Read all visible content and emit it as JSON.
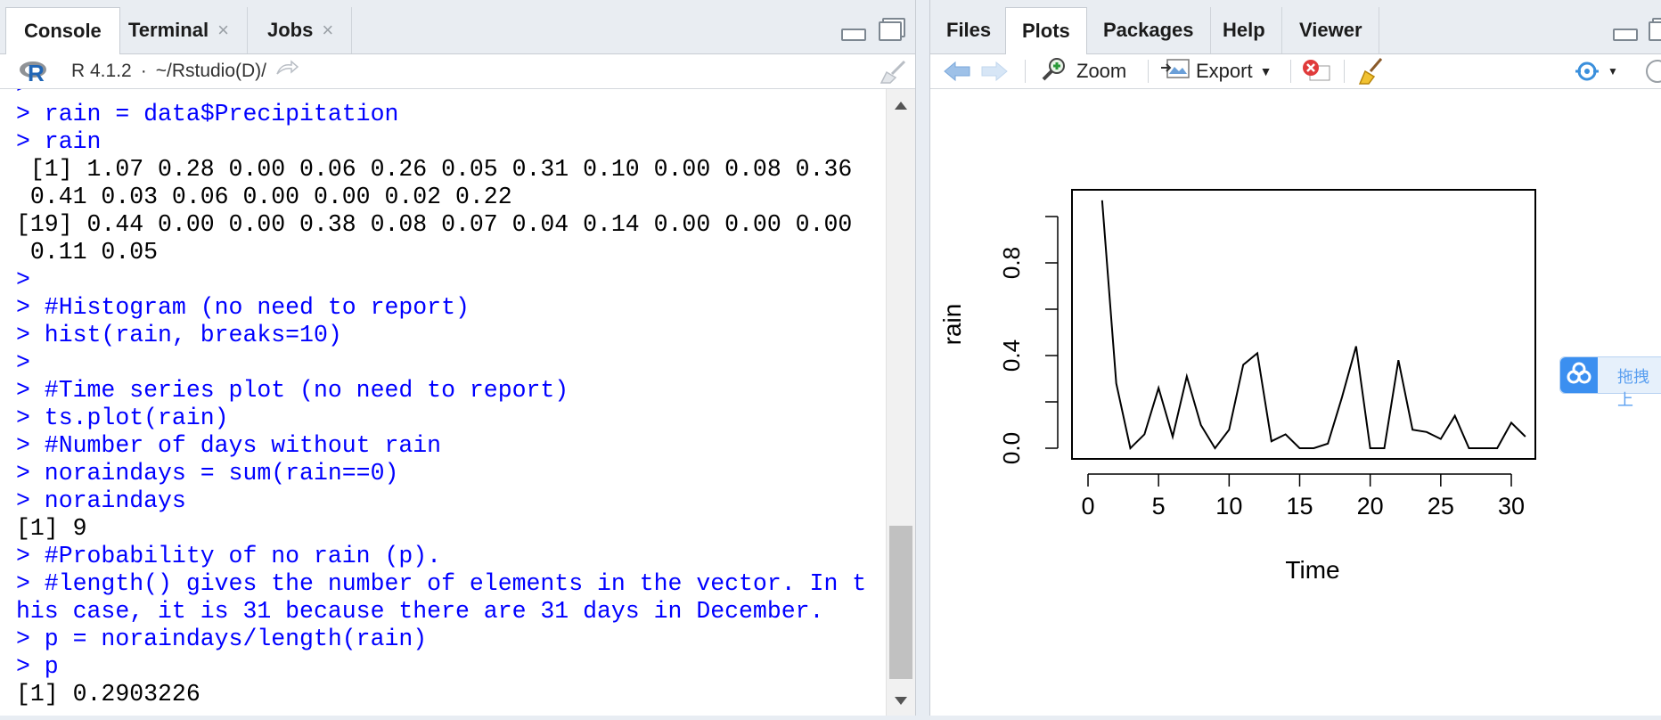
{
  "left_pane": {
    "tabs": [
      {
        "label": "Console",
        "active": true
      },
      {
        "label": "Terminal",
        "closable": true
      },
      {
        "label": "Jobs",
        "closable": true
      }
    ],
    "toolbar": {
      "r_version": "R 4.1.2",
      "separator": "·",
      "path": "~/Rstudio(D)/"
    },
    "console_lines": [
      {
        "kind": "in",
        "text": ">"
      },
      {
        "kind": "in",
        "text": "> rain = data$Precipitation"
      },
      {
        "kind": "in",
        "text": "> rain"
      },
      {
        "kind": "out",
        "text": " [1] 1.07 0.28 0.00 0.06 0.26 0.05 0.31 0.10 0.00 0.08 0.36"
      },
      {
        "kind": "out",
        "text": " 0.41 0.03 0.06 0.00 0.00 0.02 0.22"
      },
      {
        "kind": "out",
        "text": "[19] 0.44 0.00 0.00 0.38 0.08 0.07 0.04 0.14 0.00 0.00 0.00"
      },
      {
        "kind": "out",
        "text": " 0.11 0.05"
      },
      {
        "kind": "in",
        "text": ">"
      },
      {
        "kind": "in",
        "text": "> #Histogram (no need to report)"
      },
      {
        "kind": "in",
        "text": "> hist(rain, breaks=10)"
      },
      {
        "kind": "in",
        "text": ">"
      },
      {
        "kind": "in",
        "text": "> #Time series plot (no need to report)"
      },
      {
        "kind": "in",
        "text": "> ts.plot(rain)"
      },
      {
        "kind": "in",
        "text": "> #Number of days without rain"
      },
      {
        "kind": "in",
        "text": "> noraindays = sum(rain==0)"
      },
      {
        "kind": "in",
        "text": "> noraindays"
      },
      {
        "kind": "out",
        "text": "[1] 9"
      },
      {
        "kind": "in",
        "text": "> #Probability of no rain (p)."
      },
      {
        "kind": "in",
        "text": "> #length() gives the number of elements in the vector. In t"
      },
      {
        "kind": "in",
        "text": "his case, it is 31 because there are 31 days in December."
      },
      {
        "kind": "in",
        "text": "> p = noraindays/length(rain)"
      },
      {
        "kind": "in",
        "text": "> p"
      },
      {
        "kind": "out",
        "text": "[1] 0.2903226"
      }
    ]
  },
  "right_pane": {
    "tabs": [
      {
        "label": "Files"
      },
      {
        "label": "Plots",
        "active": true
      },
      {
        "label": "Packages"
      },
      {
        "label": "Help"
      },
      {
        "label": "Viewer"
      }
    ],
    "toolbar": {
      "zoom_label": "Zoom",
      "export_label": "Export"
    }
  },
  "baidu_widget": {
    "text": "拖拽上"
  },
  "chart_data": {
    "type": "line",
    "xlabel": "Time",
    "ylabel": "rain",
    "xlim": [
      0,
      31
    ],
    "ylim": [
      0,
      1.07
    ],
    "x_ticks": [
      "0",
      "5",
      "10",
      "15",
      "20",
      "25",
      "30"
    ],
    "y_ticks": [
      "0.0",
      "0.4",
      "0.8"
    ],
    "x": [
      1,
      2,
      3,
      4,
      5,
      6,
      7,
      8,
      9,
      10,
      11,
      12,
      13,
      14,
      15,
      16,
      17,
      18,
      19,
      20,
      21,
      22,
      23,
      24,
      25,
      26,
      27,
      28,
      29,
      30,
      31
    ],
    "values": [
      1.07,
      0.28,
      0.0,
      0.06,
      0.26,
      0.05,
      0.31,
      0.1,
      0.0,
      0.08,
      0.36,
      0.41,
      0.03,
      0.06,
      0.0,
      0.0,
      0.02,
      0.22,
      0.44,
      0.0,
      0.0,
      0.38,
      0.08,
      0.07,
      0.04,
      0.14,
      0.0,
      0.0,
      0.0,
      0.11,
      0.05
    ]
  }
}
